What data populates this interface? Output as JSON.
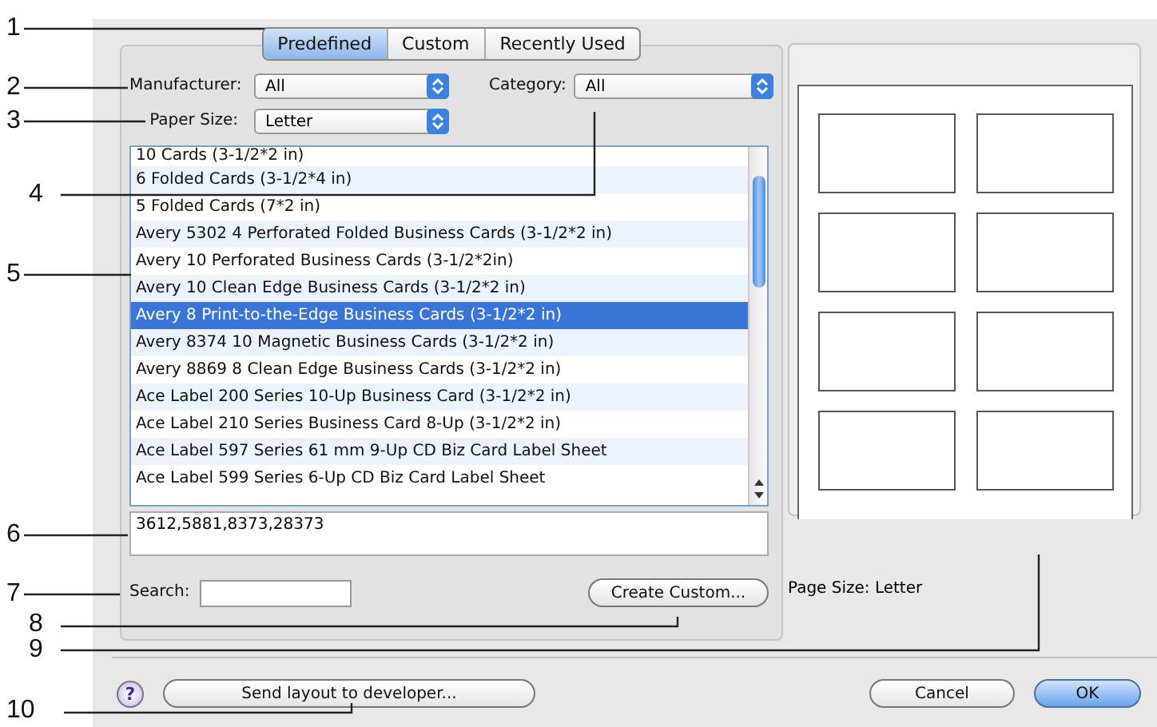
{
  "tabs": [
    {
      "label": "Predefined",
      "selected": true
    },
    {
      "label": "Custom",
      "selected": false
    },
    {
      "label": "Recently Used",
      "selected": false
    }
  ],
  "manufacturer": {
    "label": "Manufacturer:",
    "value": "All"
  },
  "category": {
    "label": "Category:",
    "value": "All"
  },
  "paper_size": {
    "label": "Paper Size:",
    "value": "Letter"
  },
  "templates": [
    {
      "name": "10 Cards (3-1/2*2 in)",
      "selected": false
    },
    {
      "name": "6 Folded Cards (3-1/2*4 in)",
      "selected": false
    },
    {
      "name": "5 Folded Cards (7*2 in)",
      "selected": false
    },
    {
      "name": "Avery 5302 4 Perforated Folded Business Cards (3-1/2*2 in)",
      "selected": false
    },
    {
      "name": "Avery 10 Perforated Business Cards (3-1/2*2in)",
      "selected": false
    },
    {
      "name": "Avery 10 Clean Edge Business Cards (3-1/2*2 in)",
      "selected": false
    },
    {
      "name": "Avery 8 Print-to-the-Edge Business Cards (3-1/2*2 in)",
      "selected": true
    },
    {
      "name": "Avery 8374 10 Magnetic Business Cards (3-1/2*2 in)",
      "selected": false
    },
    {
      "name": "Avery 8869 8 Clean Edge Business Cards (3-1/2*2 in)",
      "selected": false
    },
    {
      "name": "Ace Label 200 Series 10-Up Business Card (3-1/2*2 in)",
      "selected": false
    },
    {
      "name": "Ace Label 210 Series Business Card 8-Up (3-1/2*2 in)",
      "selected": false
    },
    {
      "name": "Ace Label 597 Series 61 mm 9-Up CD Biz Card Label Sheet",
      "selected": false
    },
    {
      "name": "Ace Label 599 Series 6-Up CD Biz Card Label Sheet",
      "selected": false
    }
  ],
  "product_codes": "3612,5881,8373,28373",
  "search": {
    "label": "Search:"
  },
  "create_custom_button": "Create Custom...",
  "page_size": "Page Size: Letter",
  "help_button": "?",
  "send_layout_button": "Send layout to developer...",
  "cancel_button": "Cancel",
  "ok_button": "OK",
  "callouts": [
    "1",
    "2",
    "3",
    "4",
    "5",
    "6",
    "7",
    "8",
    "9",
    "10"
  ]
}
